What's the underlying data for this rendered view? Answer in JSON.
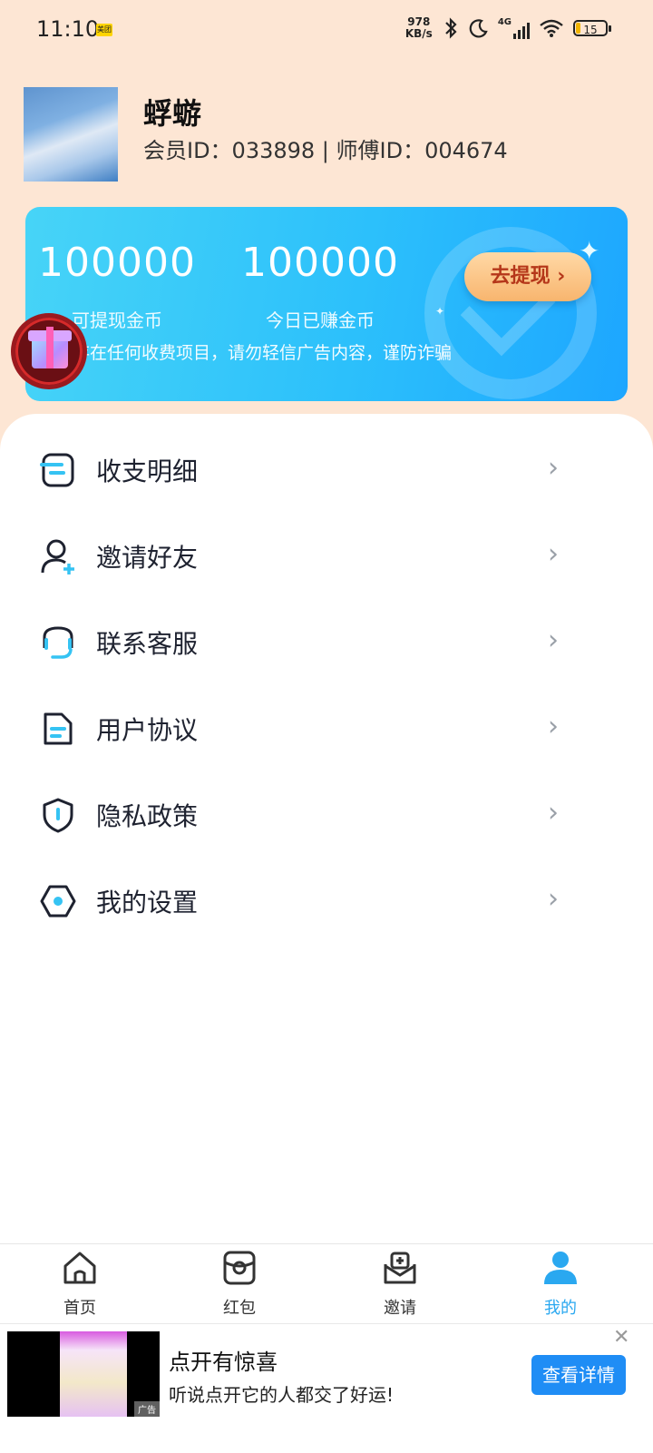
{
  "status_bar": {
    "time": "11:10",
    "app_badge": "美团",
    "net_speed_value": "978",
    "net_speed_unit": "KB/s",
    "battery": "15",
    "network": "4G"
  },
  "profile": {
    "nickname": "蜉蝣",
    "ids": "会员ID：033898 | 师傅ID：004674"
  },
  "coin_card": {
    "withdrawable_value": "100000",
    "withdrawable_label": "可提现金币",
    "today_value": "100000",
    "today_label": "今日已赚金币",
    "withdraw_button": "去提现 ›",
    "notice": "存在任何收费项目，请勿轻信广告内容，谨防诈骗"
  },
  "menu": {
    "items": [
      {
        "label": "收支明细",
        "icon": "ledger-icon"
      },
      {
        "label": "邀请好友",
        "icon": "add-user-icon"
      },
      {
        "label": "联系客服",
        "icon": "headset-icon"
      },
      {
        "label": "用户协议",
        "icon": "document-icon"
      },
      {
        "label": "隐私政策",
        "icon": "shield-icon"
      },
      {
        "label": "我的设置",
        "icon": "settings-icon"
      }
    ],
    "arrow": "›"
  },
  "tabbar": {
    "tabs": [
      {
        "label": "首页",
        "icon": "home-icon"
      },
      {
        "label": "红包",
        "icon": "red-packet-icon"
      },
      {
        "label": "邀请",
        "icon": "invite-icon"
      },
      {
        "label": "我的",
        "icon": "profile-icon"
      }
    ],
    "active_index": 3,
    "active_color": "#2aa8f0"
  },
  "ad": {
    "title": "点开有惊喜",
    "subtitle": "听说点开它的人都交了好运!",
    "button": "查看详情",
    "close": "✕",
    "tag": "广告"
  },
  "colors": {
    "page_background": "#fde6d4",
    "card_gradient_start": "#47d4f7",
    "card_gradient_end": "#1da6ff",
    "accent_blue": "#2aa8f0",
    "icon_cyan": "#35c3f3"
  }
}
